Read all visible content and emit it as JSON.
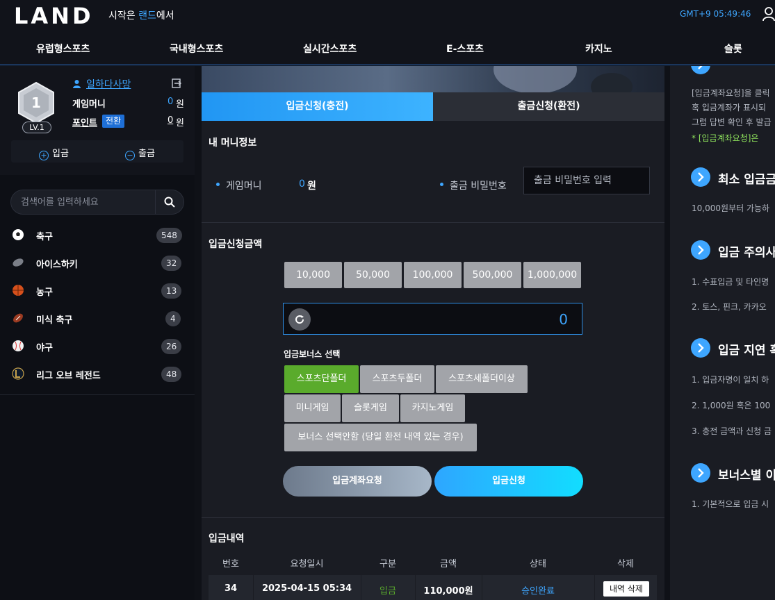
{
  "header": {
    "logo": "LAND",
    "slogan_prefix": "시작은 ",
    "slogan_highlight": "랜드",
    "slogan_suffix": "에서",
    "clock": "GMT+9 05:49:46"
  },
  "nav": [
    "유럽형스포츠",
    "국내형스포츠",
    "실시간스포츠",
    "E-스포츠",
    "카지노",
    "슬롯"
  ],
  "profile": {
    "level_number": "1",
    "level_label": "LV.1",
    "username": "일하다사망",
    "game_money_label": "게임머니",
    "game_money_value": "0",
    "game_money_unit": "원",
    "point_label": "포인트",
    "switch_label": "전환",
    "point_value": "0",
    "point_unit": "원",
    "deposit_label": "입금",
    "withdraw_label": "출금"
  },
  "search": {
    "placeholder": "검색어를 입력하세요"
  },
  "sports": [
    {
      "label": "축구",
      "count": "548",
      "icon": "soccer-ball-icon"
    },
    {
      "label": "아이스하키",
      "count": "32",
      "icon": "hockey-puck-icon"
    },
    {
      "label": "농구",
      "count": "13",
      "icon": "basketball-icon"
    },
    {
      "label": "미식 축구",
      "count": "4",
      "icon": "american-football-icon"
    },
    {
      "label": "야구",
      "count": "26",
      "icon": "baseball-icon"
    },
    {
      "label": "리그 오브 레전드",
      "count": "48",
      "icon": "lol-icon"
    }
  ],
  "tabs": {
    "deposit": "입금신청(충전)",
    "withdraw": "출금신청(환전)"
  },
  "money_info": {
    "title": "내 머니정보",
    "game_money_label": "게임머니",
    "game_money_value": "0",
    "game_money_unit": "원",
    "withdraw_pw_label": "출금 비밀번호",
    "withdraw_pw_placeholder": "출금 비밀번호 입력"
  },
  "deposit_amount": {
    "title": "입금신청금액",
    "quick_amounts": [
      "10,000",
      "50,000",
      "100,000",
      "500,000",
      "1,000,000"
    ],
    "current": "0"
  },
  "bonus": {
    "title": "입금보너스 선택",
    "options": [
      "스포츠단폴더",
      "스포츠두폴더",
      "스포츠세폴더이상",
      "미니게임",
      "슬롯게임",
      "카지노게임",
      "보너스 선택안함 (당일 환전 내역 있는 경우)"
    ],
    "selected": "스포츠단폴더"
  },
  "actions": {
    "account_request": "입금계좌요청",
    "deposit_request": "입금신청"
  },
  "history": {
    "title": "입금내역",
    "columns": [
      "번호",
      "요청일시",
      "구분",
      "금액",
      "상태",
      "삭제"
    ],
    "rows": [
      {
        "no": "34",
        "datetime": "2025-04-15 05:34",
        "type": "입금",
        "amount": "110,000원",
        "status": "승인완료",
        "delete": "내역 삭제"
      }
    ]
  },
  "right_panel": {
    "line1": "[입금계좌요청]을 클릭",
    "line2": "혹 입금계좌가 표시되",
    "line3": "그럼 답변 확인 후 발급",
    "line4": "* [입금계좌요청]은",
    "h1": "최소 입금금",
    "t1": "10,000원부터 가능하",
    "h2": "입금 주의사",
    "t2a": "1. 수표입금 및 타인명",
    "t2b": "2. 토스, 핀크, 카카오",
    "h3": "입금 지연 혹",
    "t3a": "1. 입금자명이 일치 하",
    "t3b": "2. 1,000원 혹은 100",
    "t3c": "3. 충전 금액과 신청 금",
    "h4": "보너스별 이",
    "t4a": "1. 기본적으로 입금 시"
  },
  "colors": {
    "accent": "#3ea6ff",
    "bonus_selected": "#5aab2c",
    "status_ok": "#3ea6ff",
    "type_deposit": "#5aab2c"
  }
}
